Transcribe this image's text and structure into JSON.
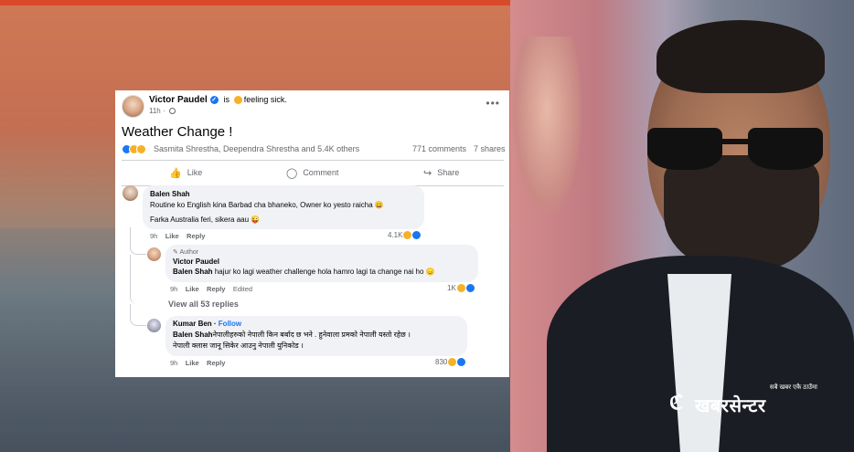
{
  "post": {
    "author": "Victor Paudel",
    "is_label": "is",
    "feeling": "feeling sick.",
    "time": "11h",
    "more_label": "•••",
    "text": "Weather Change !",
    "reaction_names": "Sasmita Shrestha, Deependra Shrestha and 5.4K others",
    "comments_count": "771 comments",
    "shares_count": "7 shares"
  },
  "actions": {
    "like": "Like",
    "comment": "Comment",
    "share": "Share"
  },
  "comments": [
    {
      "name": "Balen Shah",
      "lines": [
        "Routine ko English kina Barbad cha bhaneko, Owner ko yesto raicha 😀",
        "Farka Australia feri, sikera aau 😜"
      ],
      "time": "9h",
      "like": "Like",
      "reply": "Reply",
      "reactions": "4.1K"
    },
    {
      "author_tag": "Author",
      "name": "Victor Paudel",
      "mention": "Balen Shah",
      "text": "hajur ko lagi weather challenge hola hamro lagi ta change nai ho 😞",
      "time": "9h",
      "like": "Like",
      "reply": "Reply",
      "edited": "Edited",
      "reactions": "1K"
    },
    {
      "name": "Kumar Ben",
      "follow": "Follow",
      "mention": "Balen Shah",
      "line1": "नेपालीहरुको नेपाली किन बर्बाद छ भने . हुनेवाला प्रमको नेपाली यस्तो रहेछ ।",
      "line2": "नेपाली क्लास जानू सिकेर आउनु नेपाली युनिकोड ।",
      "time": "9h",
      "like": "Like",
      "reply": "Reply",
      "reactions": "830"
    }
  ],
  "view_all": "View all 53 replies",
  "watermark": {
    "tagline": "सबै खबर एकै ठाउँमा",
    "brand": "खबरसेन्टर"
  },
  "colors": {
    "facebook_blue": "#1877f2",
    "bubble_bg": "#f0f2f5",
    "meta_gray": "#65676b"
  }
}
